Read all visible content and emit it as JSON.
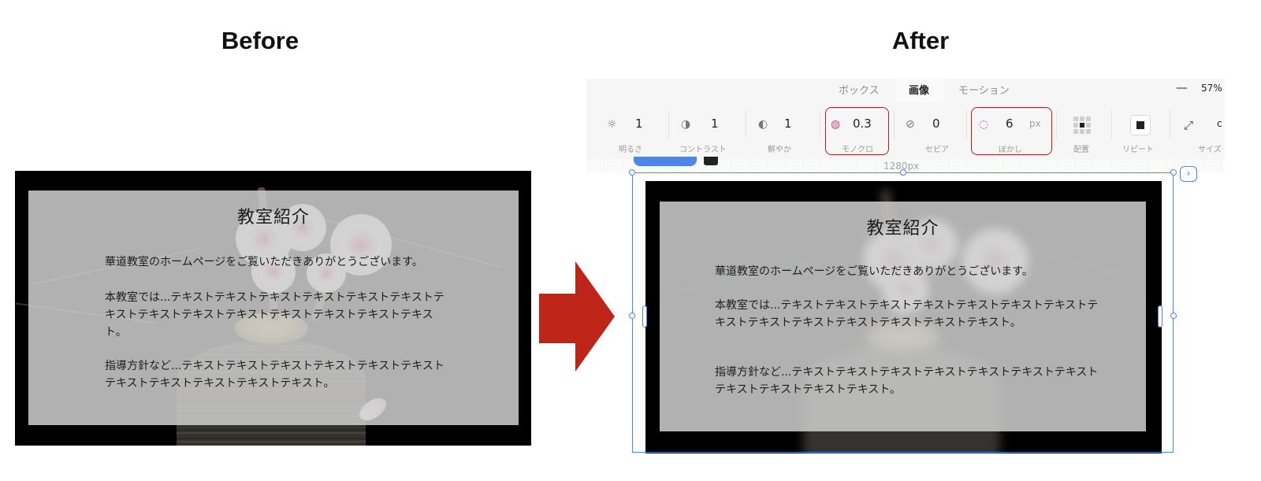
{
  "headings": {
    "before": "Before",
    "after": "After"
  },
  "page": {
    "title": "教室紹介",
    "paragraph1": "華道教室のホームページをご覧いただきありがとうございます。",
    "paragraph2": "本教室では...テキストテキストテキストテキストテキストテキストテキストテキストテキストテキストテキストテキストテキストテキスト。",
    "paragraph3": "指導方針など...テキストテキストテキストテキストテキストテキストテキストテキストテキストテキストテキスト。"
  },
  "editor": {
    "tabs": [
      "ボックス",
      "画像",
      "モーション"
    ],
    "active_tab": "画像",
    "zoom_minus": "—",
    "zoom": "57%",
    "controls": [
      {
        "icon": "sun-icon",
        "value": "1",
        "label": "明るさ"
      },
      {
        "icon": "contrast-icon",
        "value": "1",
        "label": "コントラスト"
      },
      {
        "icon": "saturation-icon",
        "value": "1",
        "label": "鮮やか"
      },
      {
        "icon": "monochrome-icon",
        "value": "0.3",
        "label": "モノクロ",
        "highlighted": true
      },
      {
        "icon": "sepia-icon",
        "value": "0",
        "label": "セピア"
      },
      {
        "icon": "blur-icon",
        "value": "6",
        "unit": "px",
        "label": "ぼかし",
        "highlighted": true
      },
      {
        "icon": "grid-icon",
        "value": "",
        "label": "配置"
      },
      {
        "icon": "repeat-icon",
        "value": "",
        "label": "リピート"
      },
      {
        "icon": "expand-icon",
        "value": "c",
        "label": "サイズ"
      }
    ],
    "ruler_label": "1280px"
  },
  "colors": {
    "highlight": "#b31e1e",
    "arrow": "#bf2418",
    "selection": "#4d86e8"
  }
}
